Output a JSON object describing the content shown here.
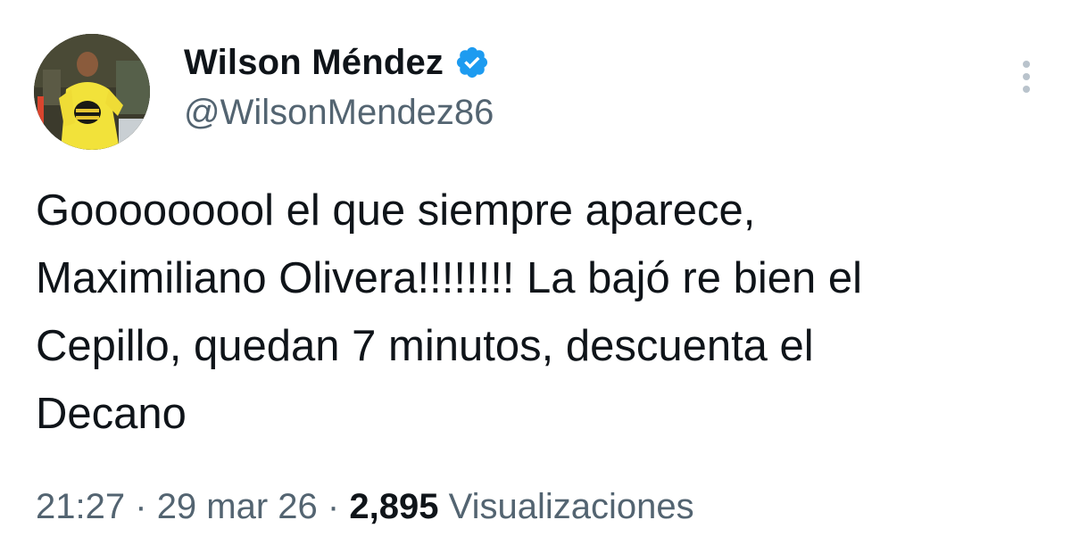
{
  "author": {
    "display_name": "Wilson Méndez",
    "handle": "@WilsonMendez86",
    "verified": true,
    "verified_badge_color": "#1d9bf0"
  },
  "tweet": {
    "text": "Gooooooool el que siempre aparece,\nMaximiliano Olivera!!!!!!!! La bajó re bien el\nCepillo, quedan 7 minutos, descuenta el\nDecano",
    "time": "21:27",
    "separator": "·",
    "date": "29 mar 26",
    "views_count": "2,895",
    "views_label": "Visualizaciones"
  },
  "icons": {
    "more": "more-vertical-icon",
    "verified": "verified-badge-icon"
  },
  "colors": {
    "text_primary": "#0f1419",
    "text_secondary": "#536471"
  }
}
